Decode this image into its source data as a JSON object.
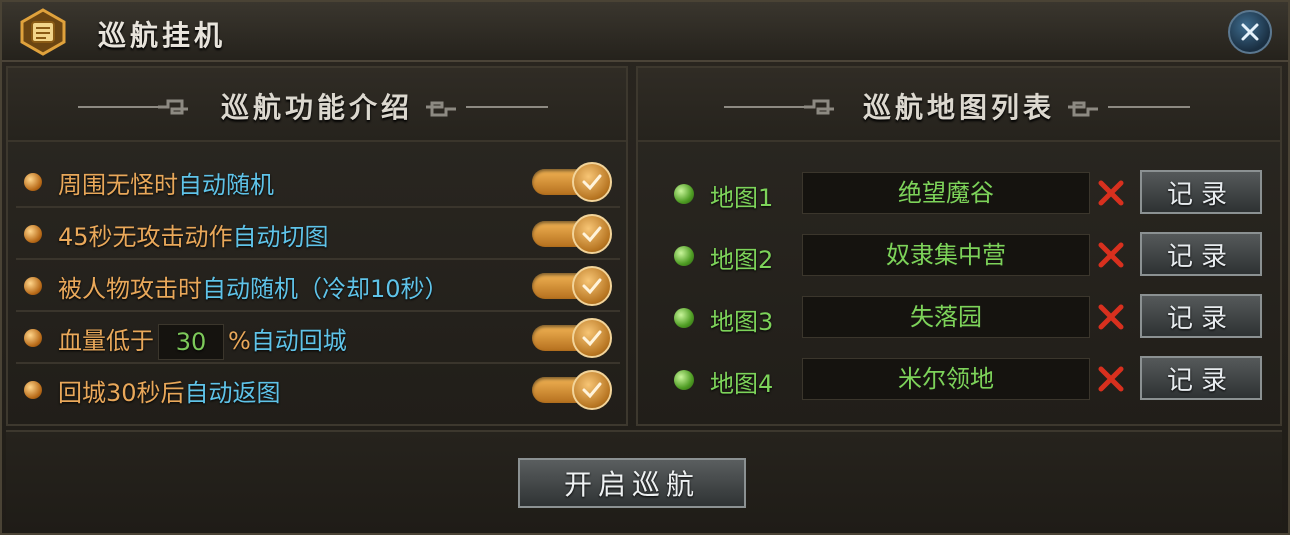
{
  "window": {
    "title": "巡航挂机",
    "close_icon": "close-icon"
  },
  "left_panel": {
    "title": "巡航功能介绍",
    "options": [
      {
        "text": "周围无怪时",
        "highlight": "自动随机",
        "suffix": "",
        "enabled": true
      },
      {
        "text": "45秒无攻击动作",
        "highlight": "自动切图",
        "suffix": "",
        "enabled": true
      },
      {
        "text": "被人物攻击时",
        "highlight": "自动随机（冷却10秒）",
        "suffix": "",
        "enabled": true
      },
      {
        "text": "血量低于",
        "hp_value": "30",
        "unit": "%",
        "highlight": "自动回城",
        "enabled": true
      },
      {
        "text": "回城30秒后",
        "highlight": "自动返图",
        "suffix": "",
        "enabled": true
      }
    ]
  },
  "right_panel": {
    "title": "巡航地图列表",
    "record_label": "记录",
    "maps": [
      {
        "label": "地图1",
        "name": "绝望魔谷"
      },
      {
        "label": "地图2",
        "name": "奴隶集中营"
      },
      {
        "label": "地图3",
        "name": "失落园"
      },
      {
        "label": "地图4",
        "name": "米尔领地"
      }
    ]
  },
  "footer": {
    "start_label": "开启巡航"
  },
  "colors": {
    "orange_text": "#e9a85a",
    "blue_highlight": "#5fc3e8",
    "green_text": "#7dd35a",
    "delete_red": "#d8301e"
  }
}
